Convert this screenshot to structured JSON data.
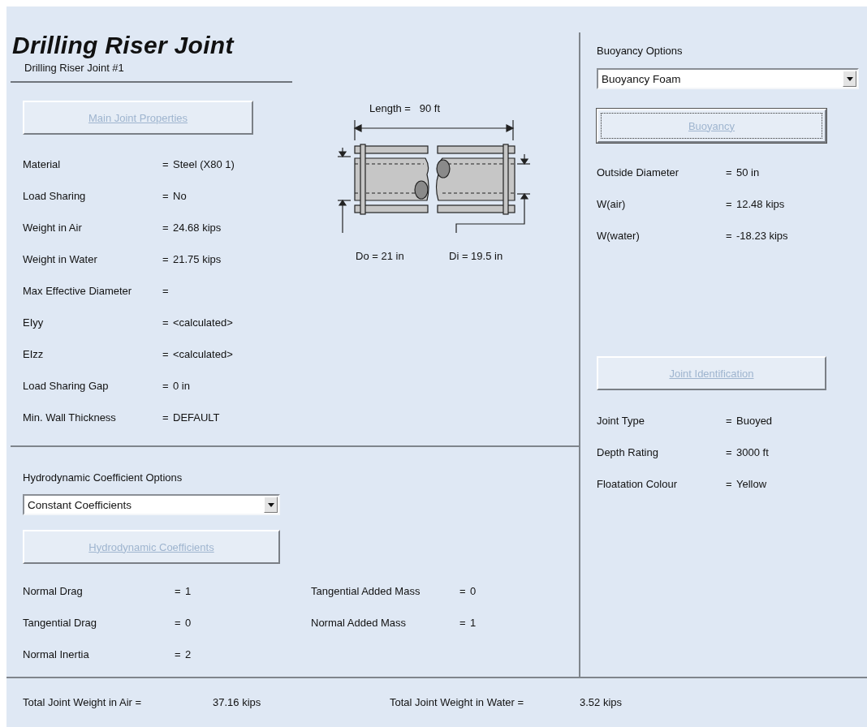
{
  "header": {
    "title": "Drilling Riser Joint",
    "subtitle": "Drilling Riser Joint #1"
  },
  "joint_properties": {
    "button": {
      "label": "Main Joint Properties",
      "disabled": true,
      "focused": false
    },
    "rows": [
      {
        "label": "Material",
        "sign": "=",
        "value": "Steel (X80 1)"
      },
      {
        "label": "Load Sharing",
        "sign": "=",
        "value": "No"
      },
      {
        "label": "Weight in Air",
        "sign": "=",
        "value": "24.68 kips"
      },
      {
        "label": "Weight in Water",
        "sign": "=",
        "value": "21.75 kips"
      },
      {
        "label": "Max Effective Diameter",
        "sign": "="
      },
      {
        "label": "EIyy",
        "sign": "=",
        "value": "<calculated>"
      },
      {
        "label": "EIzz",
        "sign": "=",
        "value": "<calculated>"
      },
      {
        "label": "Load Sharing Gap",
        "sign": "=",
        "value": "0 in"
      },
      {
        "label": "Min. Wall Thickness",
        "sign": "=",
        "value": "DEFAULT"
      }
    ]
  },
  "diagram": {
    "length_label": "Length =   90 ft",
    "outer_diameter_label": "Do = 21 in",
    "inner_diameter_label": "Di = 19.5 in"
  },
  "hydrodynamics": {
    "options_label": "Hydrodynamic Coefficient Options",
    "dropdown": {
      "value": "Constant Coefficients"
    },
    "button": {
      "label": "Hydrodynamic Coefficients",
      "disabled": true,
      "focused": false
    },
    "rows_left": [
      {
        "label": "Normal Drag",
        "sign": "=",
        "value": "1"
      },
      {
        "label": "Tangential Drag",
        "sign": "=",
        "value": "0"
      },
      {
        "label": "Normal Inertia",
        "sign": "=",
        "value": "2"
      }
    ],
    "rows_right": [
      {
        "label": "Tangential Added Mass",
        "sign": "=",
        "value": "0"
      },
      {
        "label": "Normal Added Mass",
        "sign": "=",
        "value": "1"
      }
    ]
  },
  "buoyancy": {
    "options_label": "Buoyancy Options",
    "dropdown": {
      "value": "Buoyancy Foam"
    },
    "button": {
      "label": "Buoyancy",
      "disabled": true,
      "focused": true
    },
    "rows": [
      {
        "label": "Outside Diameter",
        "sign": "=",
        "value": "50 in"
      },
      {
        "label": "W(air)",
        "sign": "=",
        "value": "12.48 kips"
      },
      {
        "label": "W(water)",
        "sign": "=",
        "value": "-18.23 kips"
      }
    ]
  },
  "identification": {
    "button": {
      "label": "Joint Identification",
      "disabled": true,
      "focused": false
    },
    "rows": [
      {
        "label": "Joint Type",
        "sign": "=",
        "value": "Buoyed"
      },
      {
        "label": "Depth Rating",
        "sign": "=",
        "value": "3000 ft"
      },
      {
        "label": "Floatation Colour",
        "sign": "=",
        "value": "Yellow"
      }
    ]
  },
  "totals": [
    {
      "label": "Total Joint Weight in Air =",
      "value": "37.16 kips"
    },
    {
      "label": "Total Joint Weight in Water =",
      "value": "3.52 kips"
    }
  ]
}
